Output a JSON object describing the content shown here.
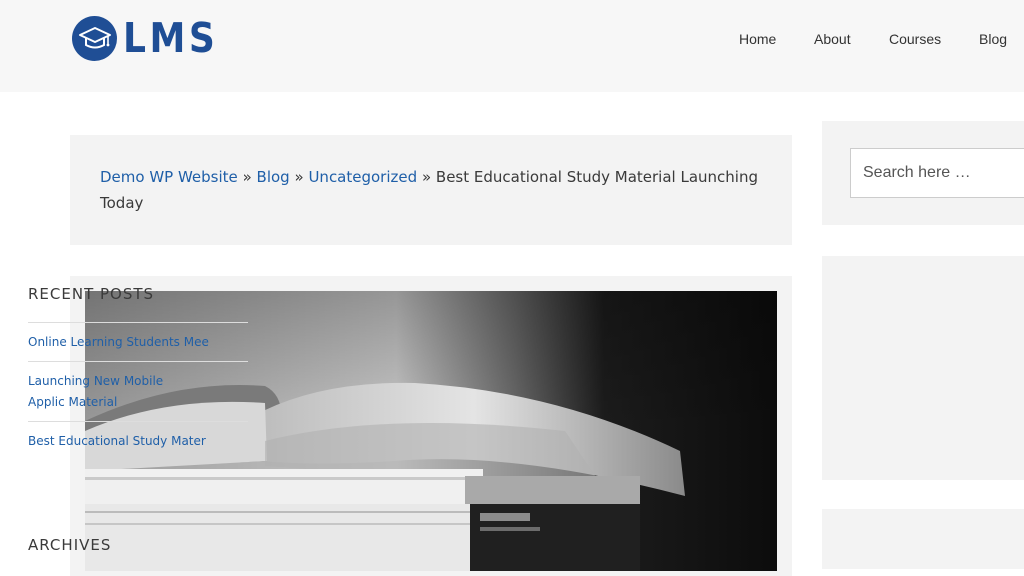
{
  "header": {
    "logo_text": "LMS",
    "nav": [
      {
        "label": "Home"
      },
      {
        "label": "About"
      },
      {
        "label": "Courses"
      },
      {
        "label": "Blog"
      }
    ]
  },
  "breadcrumb": {
    "items": [
      "Demo WP Website",
      "Blog",
      "Uncategorized"
    ],
    "separator": "»",
    "current": "Best Educational Study Material Launching Today"
  },
  "sidebar": {
    "search": {
      "placeholder": "Search here …"
    },
    "recent_posts": {
      "title": "RECENT POSTS",
      "items": [
        "Online Learning Students Mee",
        "Launching New Mobile Applic Material",
        "Best Educational Study Mater"
      ]
    },
    "archives": {
      "title": "ARCHIVES"
    }
  },
  "colors": {
    "brand": "#1f4e95",
    "link": "#1f5fa8",
    "panel": "#f3f3f3",
    "header_bg": "#f7f7f7"
  },
  "icons": {
    "logo": "graduation-cap-icon"
  }
}
